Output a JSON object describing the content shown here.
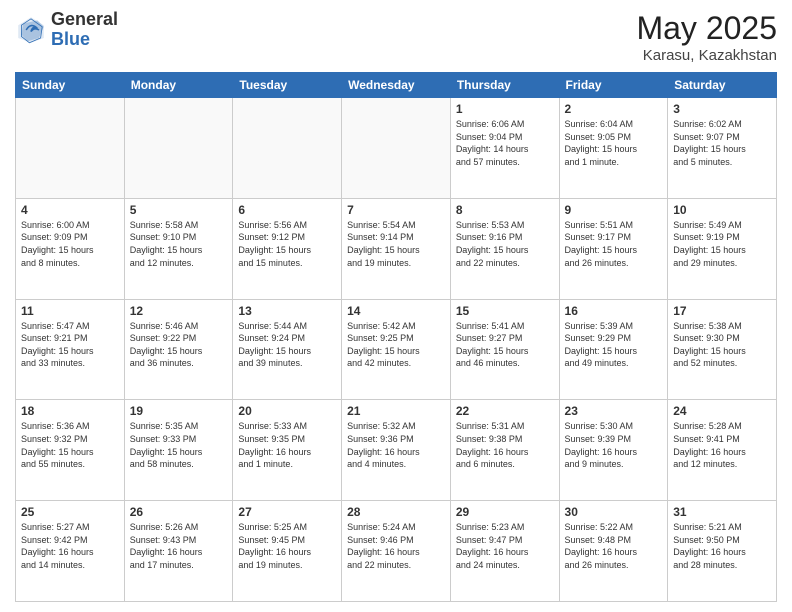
{
  "header": {
    "logo_general": "General",
    "logo_blue": "Blue",
    "main_title": "May 2025",
    "subtitle": "Karasu, Kazakhstan"
  },
  "days_of_week": [
    "Sunday",
    "Monday",
    "Tuesday",
    "Wednesday",
    "Thursday",
    "Friday",
    "Saturday"
  ],
  "weeks": [
    [
      {
        "day": "",
        "info": "",
        "empty": true
      },
      {
        "day": "",
        "info": "",
        "empty": true
      },
      {
        "day": "",
        "info": "",
        "empty": true
      },
      {
        "day": "",
        "info": "",
        "empty": true
      },
      {
        "day": "1",
        "info": "Sunrise: 6:06 AM\nSunset: 9:04 PM\nDaylight: 14 hours\nand 57 minutes."
      },
      {
        "day": "2",
        "info": "Sunrise: 6:04 AM\nSunset: 9:05 PM\nDaylight: 15 hours\nand 1 minute."
      },
      {
        "day": "3",
        "info": "Sunrise: 6:02 AM\nSunset: 9:07 PM\nDaylight: 15 hours\nand 5 minutes."
      }
    ],
    [
      {
        "day": "4",
        "info": "Sunrise: 6:00 AM\nSunset: 9:09 PM\nDaylight: 15 hours\nand 8 minutes."
      },
      {
        "day": "5",
        "info": "Sunrise: 5:58 AM\nSunset: 9:10 PM\nDaylight: 15 hours\nand 12 minutes."
      },
      {
        "day": "6",
        "info": "Sunrise: 5:56 AM\nSunset: 9:12 PM\nDaylight: 15 hours\nand 15 minutes."
      },
      {
        "day": "7",
        "info": "Sunrise: 5:54 AM\nSunset: 9:14 PM\nDaylight: 15 hours\nand 19 minutes."
      },
      {
        "day": "8",
        "info": "Sunrise: 5:53 AM\nSunset: 9:16 PM\nDaylight: 15 hours\nand 22 minutes."
      },
      {
        "day": "9",
        "info": "Sunrise: 5:51 AM\nSunset: 9:17 PM\nDaylight: 15 hours\nand 26 minutes."
      },
      {
        "day": "10",
        "info": "Sunrise: 5:49 AM\nSunset: 9:19 PM\nDaylight: 15 hours\nand 29 minutes."
      }
    ],
    [
      {
        "day": "11",
        "info": "Sunrise: 5:47 AM\nSunset: 9:21 PM\nDaylight: 15 hours\nand 33 minutes."
      },
      {
        "day": "12",
        "info": "Sunrise: 5:46 AM\nSunset: 9:22 PM\nDaylight: 15 hours\nand 36 minutes."
      },
      {
        "day": "13",
        "info": "Sunrise: 5:44 AM\nSunset: 9:24 PM\nDaylight: 15 hours\nand 39 minutes."
      },
      {
        "day": "14",
        "info": "Sunrise: 5:42 AM\nSunset: 9:25 PM\nDaylight: 15 hours\nand 42 minutes."
      },
      {
        "day": "15",
        "info": "Sunrise: 5:41 AM\nSunset: 9:27 PM\nDaylight: 15 hours\nand 46 minutes."
      },
      {
        "day": "16",
        "info": "Sunrise: 5:39 AM\nSunset: 9:29 PM\nDaylight: 15 hours\nand 49 minutes."
      },
      {
        "day": "17",
        "info": "Sunrise: 5:38 AM\nSunset: 9:30 PM\nDaylight: 15 hours\nand 52 minutes."
      }
    ],
    [
      {
        "day": "18",
        "info": "Sunrise: 5:36 AM\nSunset: 9:32 PM\nDaylight: 15 hours\nand 55 minutes."
      },
      {
        "day": "19",
        "info": "Sunrise: 5:35 AM\nSunset: 9:33 PM\nDaylight: 15 hours\nand 58 minutes."
      },
      {
        "day": "20",
        "info": "Sunrise: 5:33 AM\nSunset: 9:35 PM\nDaylight: 16 hours\nand 1 minute."
      },
      {
        "day": "21",
        "info": "Sunrise: 5:32 AM\nSunset: 9:36 PM\nDaylight: 16 hours\nand 4 minutes."
      },
      {
        "day": "22",
        "info": "Sunrise: 5:31 AM\nSunset: 9:38 PM\nDaylight: 16 hours\nand 6 minutes."
      },
      {
        "day": "23",
        "info": "Sunrise: 5:30 AM\nSunset: 9:39 PM\nDaylight: 16 hours\nand 9 minutes."
      },
      {
        "day": "24",
        "info": "Sunrise: 5:28 AM\nSunset: 9:41 PM\nDaylight: 16 hours\nand 12 minutes."
      }
    ],
    [
      {
        "day": "25",
        "info": "Sunrise: 5:27 AM\nSunset: 9:42 PM\nDaylight: 16 hours\nand 14 minutes."
      },
      {
        "day": "26",
        "info": "Sunrise: 5:26 AM\nSunset: 9:43 PM\nDaylight: 16 hours\nand 17 minutes."
      },
      {
        "day": "27",
        "info": "Sunrise: 5:25 AM\nSunset: 9:45 PM\nDaylight: 16 hours\nand 19 minutes."
      },
      {
        "day": "28",
        "info": "Sunrise: 5:24 AM\nSunset: 9:46 PM\nDaylight: 16 hours\nand 22 minutes."
      },
      {
        "day": "29",
        "info": "Sunrise: 5:23 AM\nSunset: 9:47 PM\nDaylight: 16 hours\nand 24 minutes."
      },
      {
        "day": "30",
        "info": "Sunrise: 5:22 AM\nSunset: 9:48 PM\nDaylight: 16 hours\nand 26 minutes."
      },
      {
        "day": "31",
        "info": "Sunrise: 5:21 AM\nSunset: 9:50 PM\nDaylight: 16 hours\nand 28 minutes."
      }
    ]
  ]
}
